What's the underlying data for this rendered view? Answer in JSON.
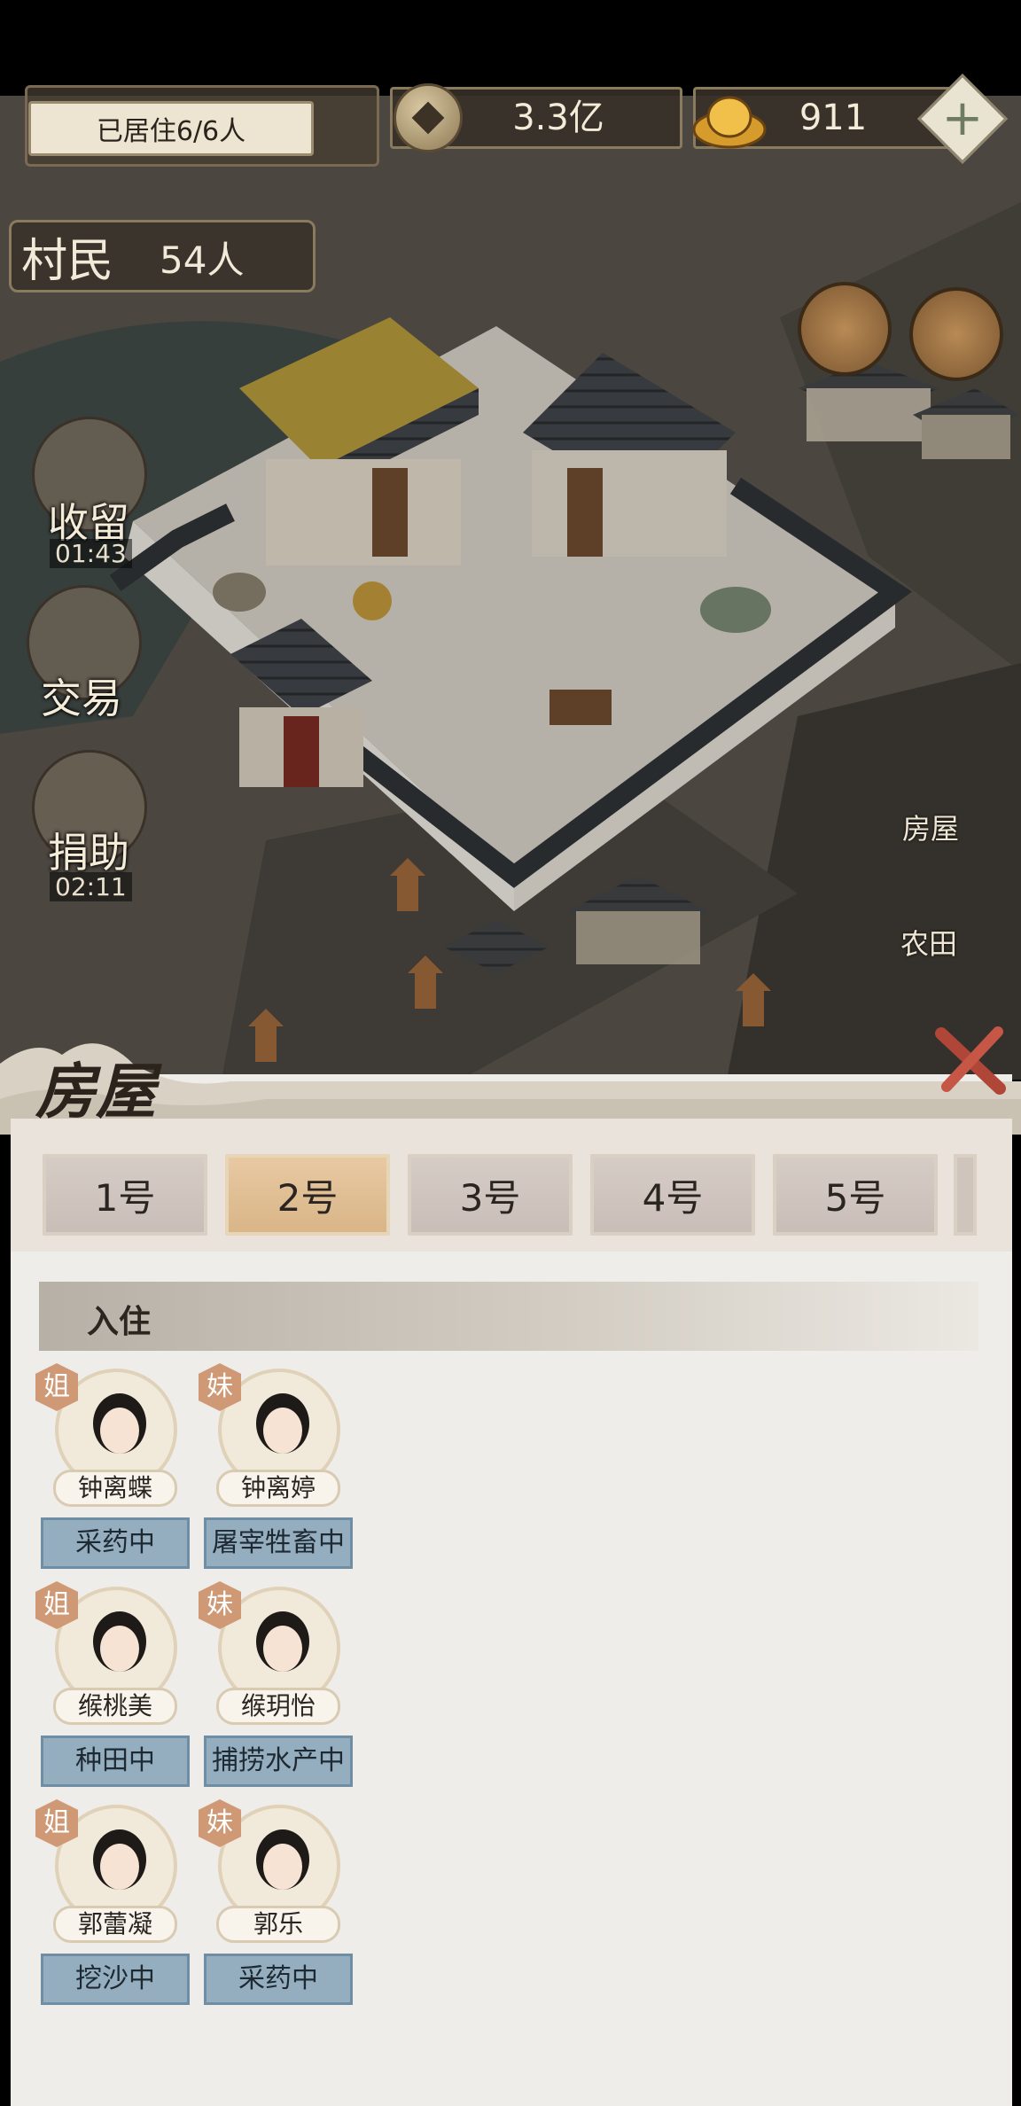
{
  "hud": {
    "residents_status": "已居住6/6人",
    "coins": "3.3亿",
    "gold": "911",
    "villagers_label": "村民",
    "villagers_count": "54人"
  },
  "side_buttons": [
    {
      "label": "收留",
      "timer": "01:43"
    },
    {
      "label": "交易",
      "timer": ""
    },
    {
      "label": "捐助",
      "timer": "02:11"
    }
  ],
  "right_menu": [
    "房屋",
    "农田"
  ],
  "panel": {
    "title": "房屋",
    "tabs": [
      "1号",
      "2号",
      "3号",
      "4号",
      "5号"
    ],
    "active_tab": "2号",
    "section_label": "入住",
    "residents": [
      {
        "badge": "姐",
        "name": "钟离蝶",
        "job": "采药中"
      },
      {
        "badge": "妹",
        "name": "钟离婷",
        "job": "屠宰牲畜中"
      },
      {
        "badge": "姐",
        "name": "缑桃美",
        "job": "种田中"
      },
      {
        "badge": "妹",
        "name": "缑玥怡",
        "job": "捕捞水产中"
      },
      {
        "badge": "姐",
        "name": "郭蕾凝",
        "job": "挖沙中"
      },
      {
        "badge": "妹",
        "name": "郭乐",
        "job": "采药中"
      }
    ]
  },
  "colors": {
    "active_tab": "#d9b588",
    "job_button": "#95aebf",
    "badge": "#cf9976",
    "panel_bg": "#efedea"
  }
}
